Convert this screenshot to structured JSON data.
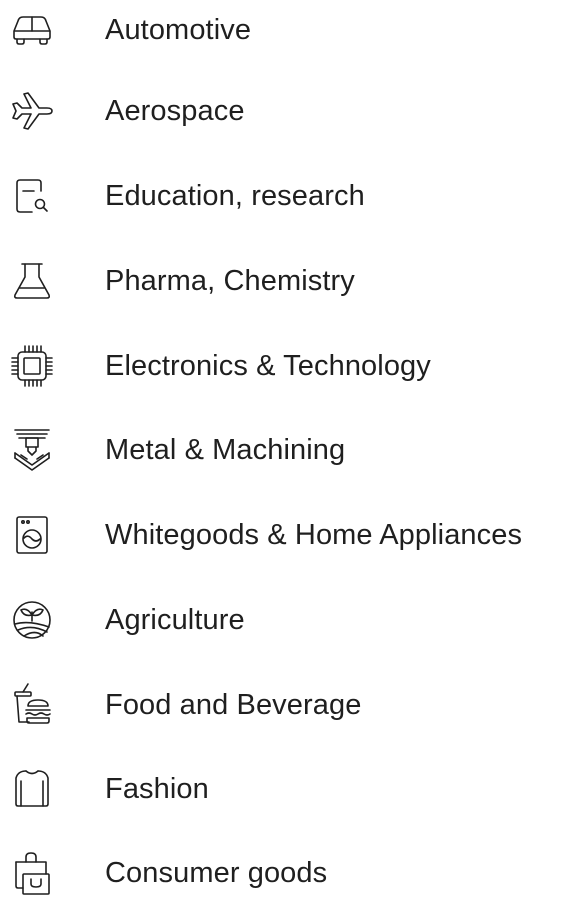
{
  "industries": [
    {
      "label": "Automotive",
      "icon": "car-icon"
    },
    {
      "label": "Aerospace",
      "icon": "airplane-icon"
    },
    {
      "label": "Education, research",
      "icon": "document-search-icon"
    },
    {
      "label": "Pharma, Chemistry",
      "icon": "flask-icon"
    },
    {
      "label": "Electronics & Technology",
      "icon": "microchip-icon"
    },
    {
      "label": "Metal & Machining",
      "icon": "press-machine-icon"
    },
    {
      "label": "Whitegoods & Home Appliances",
      "icon": "washing-machine-icon"
    },
    {
      "label": "Agriculture",
      "icon": "sprout-field-icon"
    },
    {
      "label": "Food and Beverage",
      "icon": "drink-burger-icon"
    },
    {
      "label": "Fashion",
      "icon": "sweater-icon"
    },
    {
      "label": "Consumer goods",
      "icon": "shopping-bag-icon"
    }
  ]
}
